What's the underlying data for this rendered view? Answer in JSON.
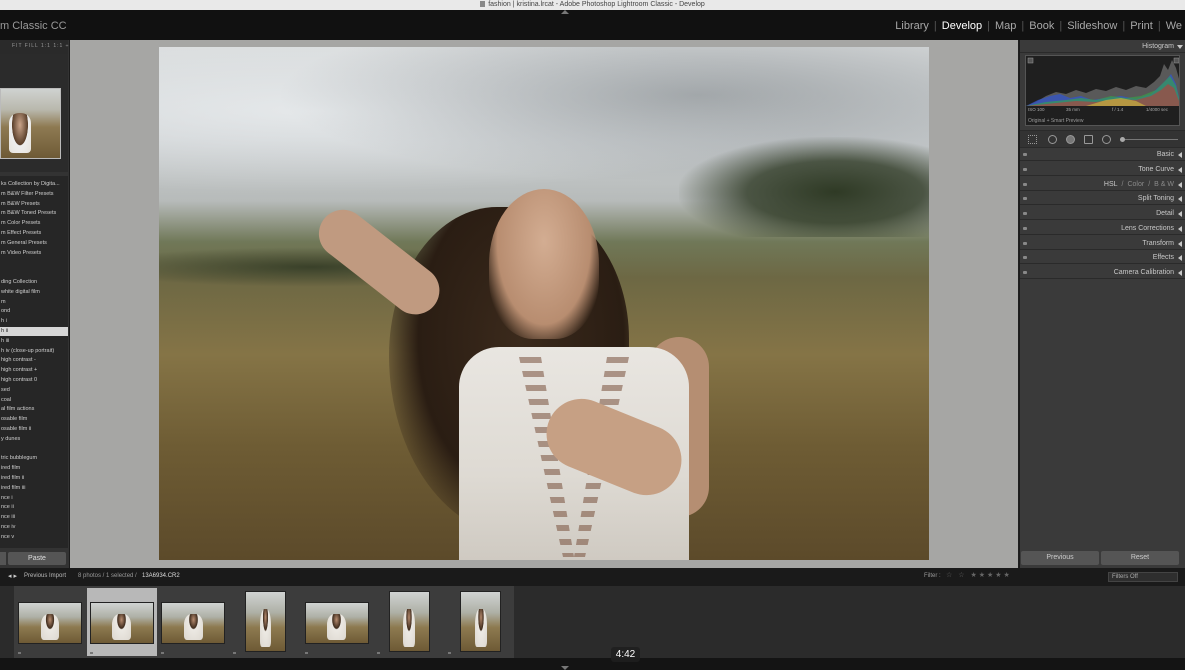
{
  "window": {
    "title": "fashion | kristina.lrcat - Adobe Photoshop Lightroom Classic - Develop"
  },
  "app": {
    "logo_text": "m Classic CC"
  },
  "modules": [
    {
      "label": "Library",
      "active": false
    },
    {
      "label": "Develop",
      "active": true
    },
    {
      "label": "Map",
      "active": false
    },
    {
      "label": "Book",
      "active": false
    },
    {
      "label": "Slideshow",
      "active": false
    },
    {
      "label": "Print",
      "active": false
    },
    {
      "label": "We",
      "active": false
    }
  ],
  "navigator": {
    "zoom_options": "FIT FILL 1:1 1:1 ÷"
  },
  "presets": [
    "ks Collection by Digita...",
    "m B&W Filter Presets",
    "m B&W Presets",
    "m B&W Toned Presets",
    "m Color Presets",
    "m Effect Presets",
    "m General Presets",
    "m Video Presets",
    "",
    "",
    "ding Collection",
    "white digital film",
    "m",
    "ond",
    "h i",
    "h ii",
    "h iii",
    "h iv (close-up portrait)",
    "high contrast -",
    "high contrast +",
    "high contrast 0",
    "sed",
    "coal",
    "al film actions",
    "osable film",
    "osable film ii",
    "y dunes",
    "",
    "tric bubblegum",
    "ired film",
    "ired film ii",
    "ired film iii",
    "nce i",
    "nce ii",
    "nce iii",
    "nce iv",
    "nce v"
  ],
  "selected_preset_index": 15,
  "left_panel": {
    "paste_label": "Paste"
  },
  "histogram": {
    "title": "Histogram",
    "iso": "ISO 100",
    "focal": "35 mm",
    "aperture": "f / 1.4",
    "shutter": "1/4000 sec",
    "preview": "Original + Smart Preview"
  },
  "panels": [
    {
      "label": "Basic"
    },
    {
      "label": "Tone Curve"
    },
    {
      "label_parts": [
        "HSL",
        "/",
        "Color",
        "/",
        "B & W"
      ]
    },
    {
      "label": "Split Toning"
    },
    {
      "label": "Detail"
    },
    {
      "label": "Lens Corrections"
    },
    {
      "label": "Transform"
    },
    {
      "label": "Effects"
    },
    {
      "label": "Camera Calibration"
    }
  ],
  "buttons": {
    "previous": "Previous",
    "reset": "Reset"
  },
  "filmstrip": {
    "nav": "◂  ▸",
    "source": "Previous Import",
    "count": "8 photos / 1 selected /",
    "file": "13A6934.CR2",
    "filter_label": "Filter :",
    "filter_stars": "☆ ☆ ★★★★★",
    "filters_off": "Filters Off",
    "thumbs": [
      {
        "selected": false,
        "orientation": "landscape"
      },
      {
        "selected": true,
        "orientation": "landscape"
      },
      {
        "selected": false,
        "orientation": "landscape"
      },
      {
        "selected": false,
        "orientation": "portrait"
      },
      {
        "selected": false,
        "orientation": "landscape"
      },
      {
        "selected": false,
        "orientation": "portrait"
      },
      {
        "selected": false,
        "orientation": "portrait"
      }
    ]
  },
  "video": {
    "timestamp": "4:42"
  }
}
